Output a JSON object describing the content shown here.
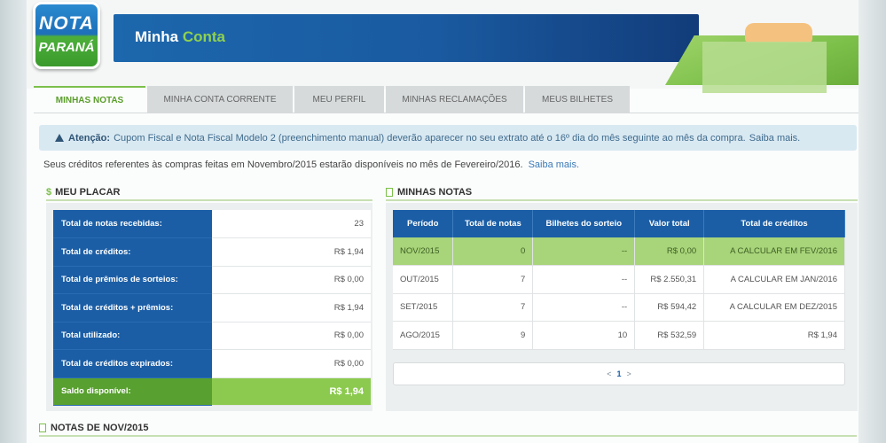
{
  "logo": {
    "line1": "NOTA",
    "line2": "PARANÁ"
  },
  "header": {
    "title_main": "Minha",
    "title_accent": "Conta"
  },
  "tabs": [
    {
      "label": "MINHAS NOTAS",
      "active": true
    },
    {
      "label": "MINHA CONTA CORRENTE"
    },
    {
      "label": "MEU PERFIL"
    },
    {
      "label": "MINHAS RECLAMAÇÕES"
    },
    {
      "label": "MEUS BILHETES"
    }
  ],
  "notice": {
    "strong": "Atenção:",
    "text": "Cupom Fiscal e Nota Fiscal Modelo 2 (preenchimento manual) deverão aparecer no seu extrato até o 16º dia do mês seguinte ao mês da compra.",
    "link": "Saiba mais."
  },
  "credits_info": {
    "text": "Seus créditos referentes às compras feitas em Novembro/2015 estarão disponíveis no mês de Fevereiro/2016.",
    "link": "Saiba mais."
  },
  "placar": {
    "title": "MEU PLACAR",
    "rows": [
      {
        "label": "Total de notas recebidas:",
        "value": "23"
      },
      {
        "label": "Total de créditos:",
        "value": "R$ 1,94"
      },
      {
        "label": "Total de prêmios de sorteios:",
        "value": "R$ 0,00"
      },
      {
        "label": "Total de créditos + prêmios:",
        "value": "R$ 1,94"
      },
      {
        "label": "Total utilizado:",
        "value": "R$ 0,00"
      },
      {
        "label": "Total de créditos expirados:",
        "value": "R$ 0,00"
      }
    ],
    "total": {
      "label": "Saldo disponível:",
      "value": "R$ 1,94"
    }
  },
  "notas": {
    "title": "MINHAS NOTAS",
    "columns": [
      "Período",
      "Total de notas",
      "Bilhetes do sorteio",
      "Valor total",
      "Total de créditos"
    ],
    "rows": [
      [
        "NOV/2015",
        "0",
        "--",
        "R$ 0,00",
        "A CALCULAR EM FEV/2016"
      ],
      [
        "OUT/2015",
        "7",
        "--",
        "R$ 2.550,31",
        "A CALCULAR EM JAN/2016"
      ],
      [
        "SET/2015",
        "7",
        "--",
        "R$ 594,42",
        "A CALCULAR EM DEZ/2015"
      ],
      [
        "AGO/2015",
        "9",
        "10",
        "R$ 532,59",
        "R$ 1,94"
      ]
    ],
    "pager": {
      "prev": "<",
      "current": "1",
      "next": ">"
    }
  },
  "notas_nov": {
    "title": "NOTAS DE NOV/2015"
  },
  "colors": {
    "brand_blue": "#1b5ea6",
    "brand_green": "#7cc04a",
    "highlight_green": "#a8d47a"
  }
}
